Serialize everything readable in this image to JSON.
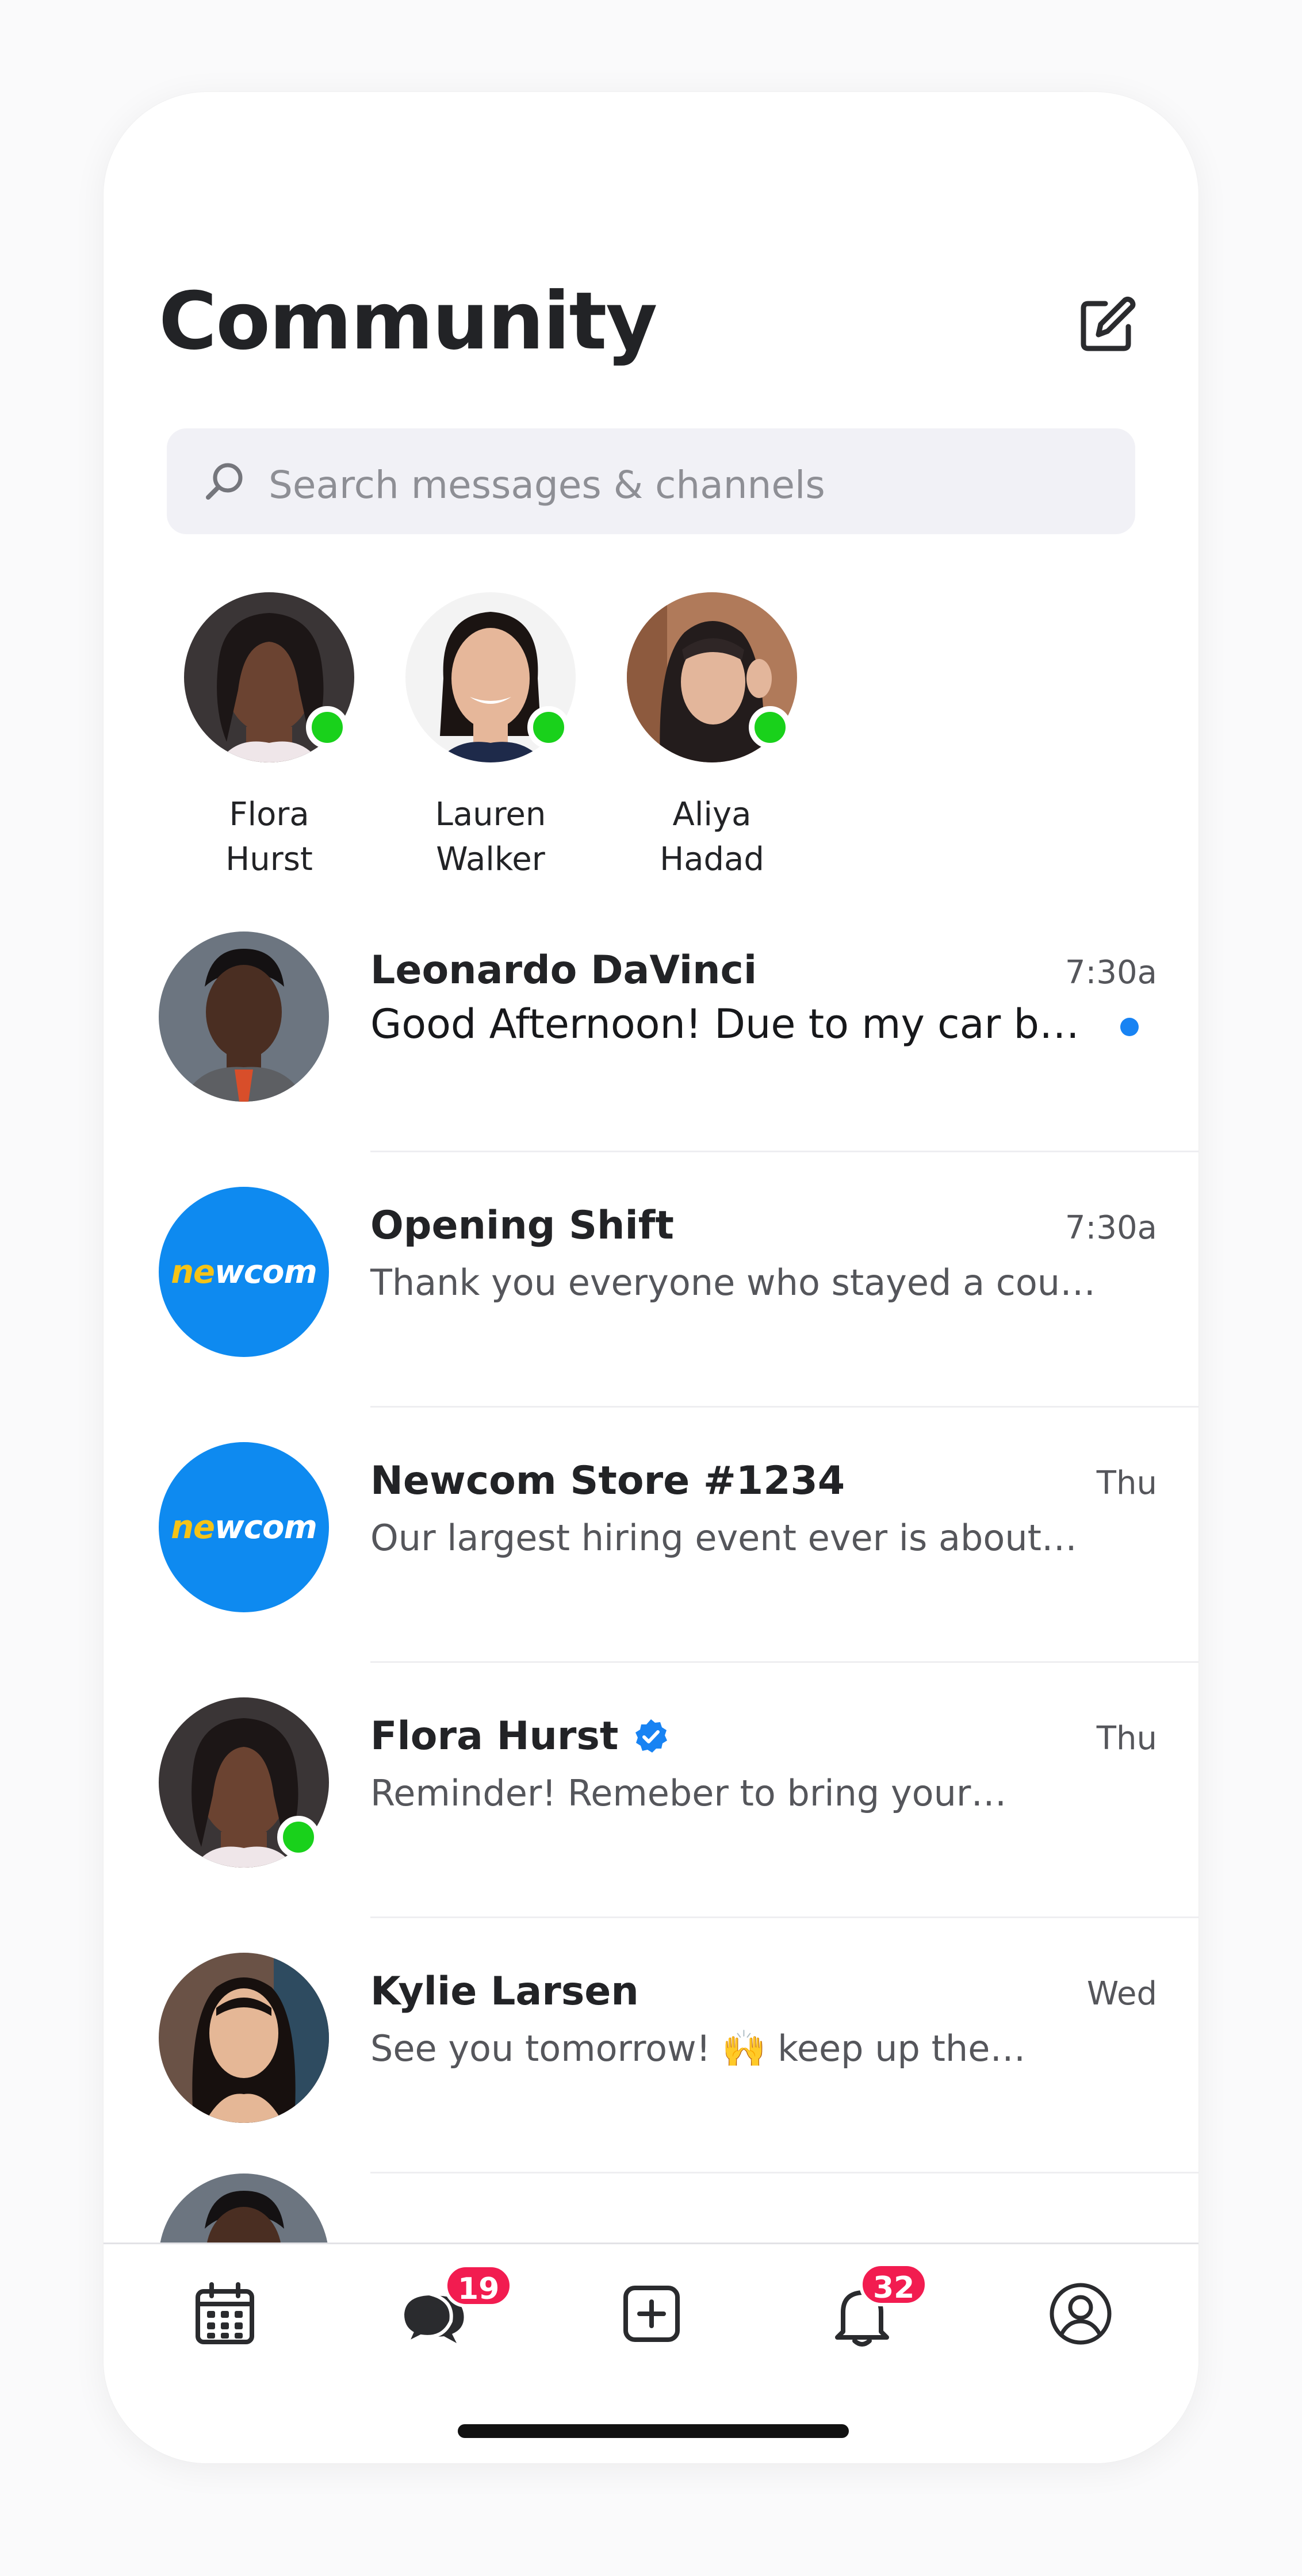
{
  "header": {
    "title": "Community"
  },
  "search": {
    "placeholder": "Search messages & channels"
  },
  "stories": [
    {
      "first": "Flora",
      "last": "Hurst",
      "online": true
    },
    {
      "first": "Lauren",
      "last": "Walker",
      "online": true
    },
    {
      "first": "Aliya",
      "last": "Hadad",
      "online": true
    }
  ],
  "conversations": [
    {
      "name": "Leonardo DaVinci",
      "time": "7:30a",
      "preview": "Good Afternoon! Due to my car b…",
      "unread": true
    },
    {
      "name": "Opening Shift",
      "time": "7:30a",
      "preview": "Thank you everyone who stayed a cou…",
      "avatar_text": "newcom"
    },
    {
      "name": "Newcom Store #1234",
      "time": "Thu",
      "preview": "Our largest hiring event ever is about…",
      "avatar_text": "newcom"
    },
    {
      "name": "Flora Hurst",
      "time": "Thu",
      "preview": "Reminder! Remeber to bring your…",
      "verified": true,
      "online": true
    },
    {
      "name": "Kylie Larsen",
      "time": "Wed",
      "preview": "See you tomorrow! 🙌 keep up the…"
    }
  ],
  "tabbar": {
    "messages_badge": "19",
    "notifications_badge": "32"
  },
  "icons": [
    "compose-icon",
    "search-icon",
    "verified-badge-icon",
    "calendar-icon",
    "chat-icon",
    "add-square-icon",
    "bell-icon",
    "profile-icon"
  ],
  "colors": {
    "online": "#19d11b",
    "unread_dot": "#1883f3",
    "brand_blue": "#0e8af0",
    "brand_yellow": "#f5c316",
    "badge": "#f21c50"
  }
}
